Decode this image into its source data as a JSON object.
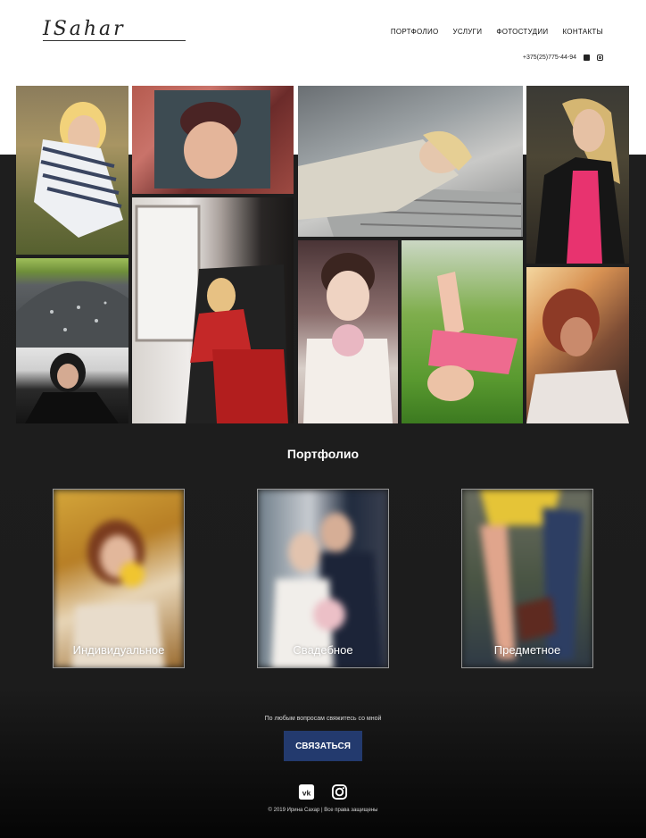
{
  "header": {
    "logo": "ISahar",
    "nav": [
      "ПОРТФОЛИО",
      "УСЛУГИ",
      "ФОТОСТУДИИ",
      "КОНТАКТЫ"
    ],
    "phone": "+375(25)775-44-94",
    "icons": [
      "vk-icon",
      "instagram-icon"
    ]
  },
  "gallery": {
    "count": 10
  },
  "portfolio": {
    "title": "Портфолио",
    "cards": [
      {
        "label": "Индивидуальное"
      },
      {
        "label": "Свадебное"
      },
      {
        "label": "Предметное"
      }
    ]
  },
  "footer": {
    "question": "По любым вопросам свяжитесь со мной",
    "button_label": "СВЯЗАТЬСЯ",
    "copyright": "© 2019 Ирина Сахар | Все права защищены",
    "social": [
      "vk-icon",
      "instagram-icon"
    ]
  },
  "colors": {
    "dark_background": "#1e1e1e",
    "button": "#233a6e",
    "header_background": "#ffffff"
  }
}
